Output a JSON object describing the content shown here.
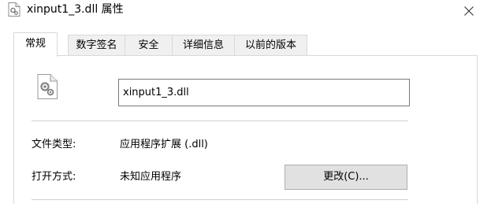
{
  "window": {
    "title": "xinput1_3.dll 属性",
    "title_icon": "dll-file-gear-icon",
    "close_icon": "close-icon"
  },
  "tabs": [
    {
      "label": "常规",
      "active": true
    },
    {
      "label": "数字签名",
      "active": false
    },
    {
      "label": "安全",
      "active": false
    },
    {
      "label": "详细信息",
      "active": false
    },
    {
      "label": "以前的版本",
      "active": false
    }
  ],
  "general": {
    "file_icon": "dll-file-gear-icon",
    "file_name": "xinput1_3.dll",
    "file_type_label": "文件类型:",
    "file_type_value": "应用程序扩展 (.dll)",
    "opens_with_label": "打开方式:",
    "opens_with_value": "未知应用程序",
    "change_button": "更改(C)..."
  }
}
